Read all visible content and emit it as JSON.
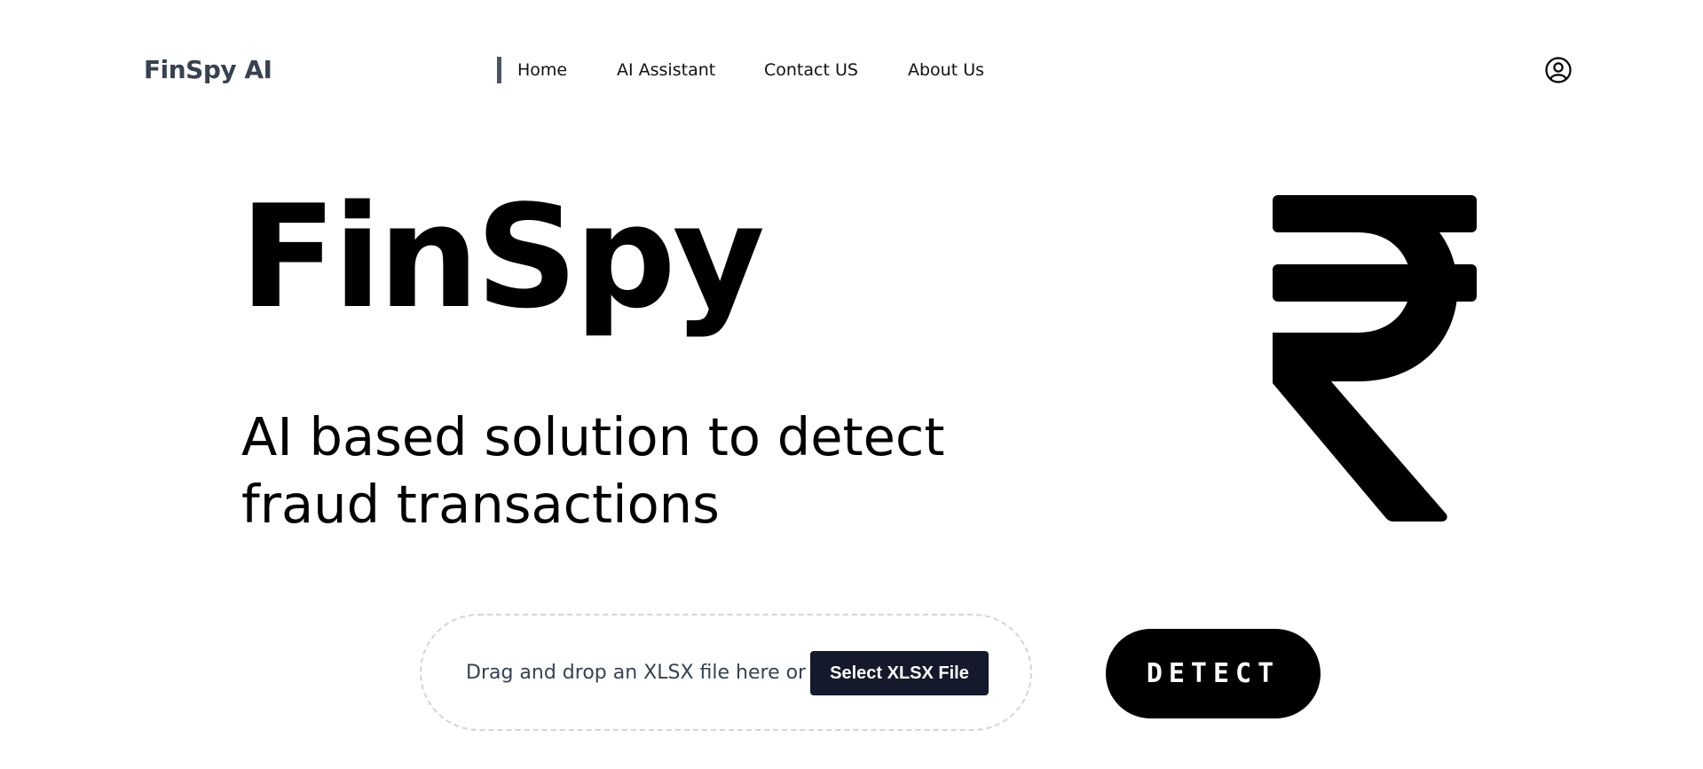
{
  "header": {
    "brand": "FinSpy AI",
    "nav": [
      {
        "label": "Home",
        "active": true
      },
      {
        "label": "AI Assistant"
      },
      {
        "label": "Contact US"
      },
      {
        "label": "About Us"
      }
    ],
    "profile_icon": "user-circle-icon"
  },
  "hero": {
    "title": "FinSpy",
    "subtitle": "AI based solution to detect fraud transactions",
    "illustration_icon": "rupee-icon"
  },
  "upload": {
    "drop_text": "Drag and drop an XLSX file here or",
    "select_label": "Select XLSX File",
    "detect_label": "DETECT"
  },
  "colors": {
    "brand_text": "#374151",
    "button_dark": "#141a2b",
    "accent_bar": "#4b5563"
  }
}
